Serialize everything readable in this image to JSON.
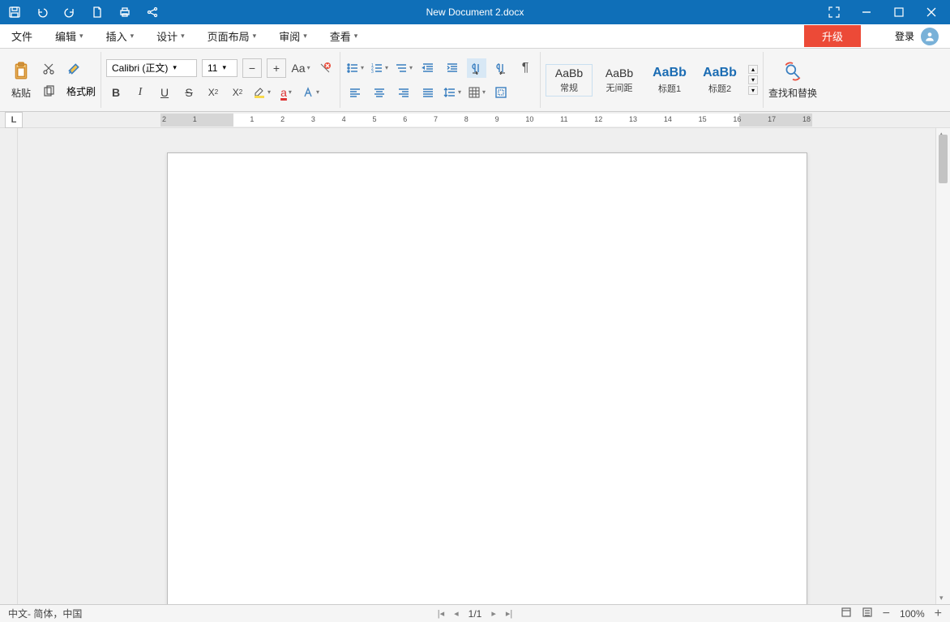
{
  "title": "New Document 2.docx",
  "menus": {
    "file": "文件",
    "edit": "编辑",
    "insert": "插入",
    "design": "设计",
    "layout": "页面布局",
    "review": "审阅",
    "view": "查看"
  },
  "upgrade_label": "升级",
  "login_label": "登录",
  "toolbar": {
    "paste": "粘贴",
    "format_painter": "格式刷",
    "font_name": "Calibri (正文)",
    "font_size": "11",
    "find_replace": "查找和替换"
  },
  "styles": {
    "normal_prev": "AaBb",
    "normal_label": "常规",
    "no_spacing_prev": "AaBb",
    "no_spacing_label": "无间距",
    "heading1_prev": "AaBb",
    "heading1_label": "标题1",
    "heading2_prev": "AaBb",
    "heading2_label": "标题2"
  },
  "ruler_numbers": [
    "2",
    "1",
    "",
    "1",
    "2",
    "3",
    "4",
    "5",
    "6",
    "7",
    "8",
    "9",
    "10",
    "11",
    "12",
    "13",
    "14",
    "15",
    "16",
    "17",
    "18"
  ],
  "status": {
    "language": "中文- 简体，中国",
    "page": "1/1",
    "zoom": "100%"
  }
}
